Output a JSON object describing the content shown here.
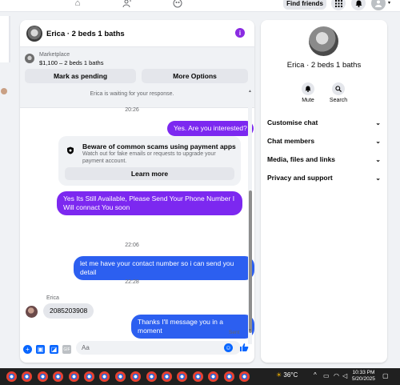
{
  "topnav": {
    "find_friends_label": "Find friends"
  },
  "chat": {
    "title": "Erica · 2 beds 1 baths",
    "marketplace": {
      "label": "Marketplace",
      "listing": "$1,100 – 2 beds 1 baths",
      "mark_pending_label": "Mark as pending",
      "more_options_label": "More Options"
    },
    "messages": {
      "waiting_notice": "Erica is waiting for your response.",
      "time1": "20:26",
      "msg1": "Yes. Are you interested?",
      "warning": {
        "title": "Beware of common scams using payment apps",
        "desc": "Watch out for fake emails or requests to upgrade your payment account.",
        "button": "Learn more"
      },
      "msg2": "Yes Its Still Available, Please Send Your Phone Number I Will connact You soon",
      "time2": "22:06",
      "msg3": "let me have your contact number so i can send you detail",
      "time3": "22:28",
      "sender_name": "Erica",
      "msg4": "2085203908",
      "msg5": "Thanks I'll message you in a moment",
      "status": "Sent"
    },
    "composer": {
      "placeholder": "Aa"
    },
    "colors": {
      "outgoing": "#2c5ff0",
      "outgoing_alt": "#7c28f0",
      "accent": "#8a2be2"
    }
  },
  "right_panel": {
    "name": "Erica · 2 beds 1 baths",
    "actions": [
      {
        "label": "Mute",
        "icon": "bell-icon"
      },
      {
        "label": "Search",
        "icon": "search-icon"
      }
    ],
    "sections": [
      {
        "label": "Customise chat"
      },
      {
        "label": "Chat members"
      },
      {
        "label": "Media, files and links"
      },
      {
        "label": "Privacy and support"
      }
    ]
  },
  "taskbar": {
    "temperature": "36°C",
    "time": "10:33 PM",
    "date": "5/20/2025"
  }
}
